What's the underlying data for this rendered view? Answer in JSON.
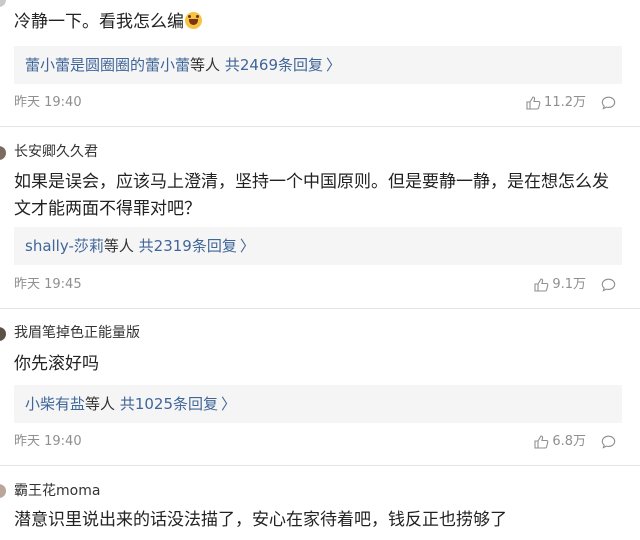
{
  "comments": [
    {
      "text": "冷静一下。看我怎么编",
      "reply": {
        "names": "蕾小蕾是圆圈圈的蕾小蕾",
        "suffix": "等人",
        "count": "共2469条回复"
      },
      "time": "昨天 19:40",
      "likes": "11.2万"
    },
    {
      "author": "长安卿久久君",
      "text": "如果是误会，应该马上澄清，坚持一个中国原则。但是要静一静，是在想怎么发文才能两面不得罪对吧？",
      "reply": {
        "names": "shally-莎莉",
        "suffix": "等人",
        "count": "共2319条回复"
      },
      "time": "昨天 19:45",
      "likes": "9.1万"
    },
    {
      "author": "我眉笔掉色正能量版",
      "text": "你先滚好吗",
      "reply": {
        "names": "小柴有盐",
        "suffix": "等人",
        "count": "共1025条回复"
      },
      "time": "昨天 19:40",
      "likes": "6.8万"
    },
    {
      "author": "霸王花moma",
      "text": "潜意识里说出来的话没法描了，安心在家待着吧，钱反正也捞够了"
    }
  ],
  "icons": {
    "like": "thumbs-up-icon",
    "comment": "comment-bubble-icon",
    "reply_more": "chevron-right-icon",
    "inline_emoji": "laughing-emoji-icon"
  },
  "colors": {
    "link": "#406599",
    "reply_bg": "#f5f5f5",
    "meta": "#8f8f8f"
  }
}
